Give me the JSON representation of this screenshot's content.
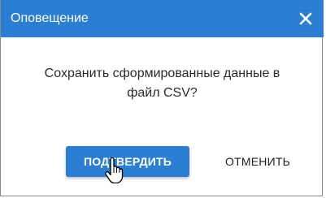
{
  "dialog": {
    "title": "Оповещение",
    "close_icon": "close-icon",
    "message_line1": "Сохранить сформированные данные в",
    "message_line2": "файл CSV?",
    "confirm_label": "ПОДТВЕРДИТЬ",
    "cancel_label": "ОТМЕНИТЬ"
  },
  "colors": {
    "header_bg": "#2a7fd4",
    "primary_button_bg": "#2a7fd4",
    "text": "#2b2b2b"
  },
  "cursor": {
    "icon": "hand-pointer-icon"
  }
}
